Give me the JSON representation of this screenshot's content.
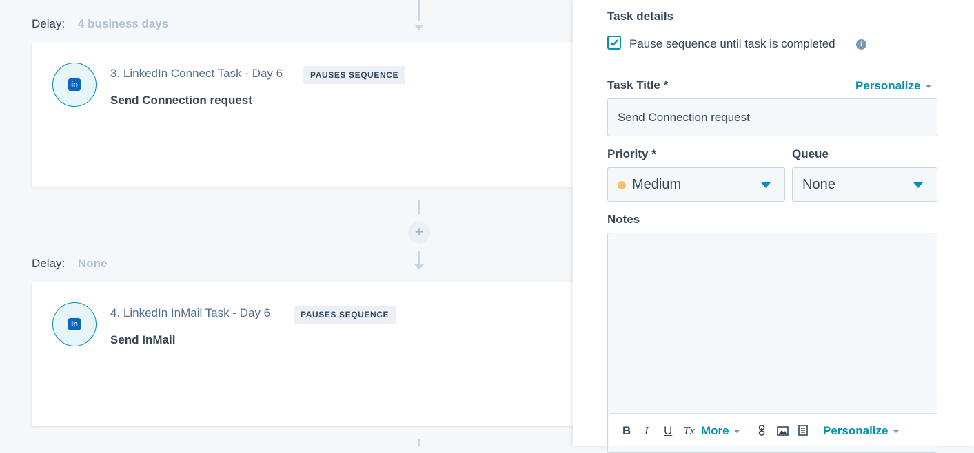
{
  "sequence": {
    "delays": [
      {
        "label": "Delay:",
        "value": "4 business days"
      },
      {
        "label": "Delay:",
        "value": "None"
      }
    ],
    "add_step_symbol": "+",
    "steps": [
      {
        "title": "3. LinkedIn Connect Task - Day 6",
        "badge": "PAUSES SEQUENCE",
        "subtitle": "Send Connection request",
        "icon": "linkedin-icon",
        "icon_text": "in"
      },
      {
        "title": "4. LinkedIn InMail Task - Day 6",
        "badge": "PAUSES SEQUENCE",
        "subtitle": "Send InMail",
        "icon": "linkedin-icon",
        "icon_text": "in"
      }
    ]
  },
  "task_panel": {
    "heading": "Task details",
    "pause_checkbox": {
      "label": "Pause sequence until task is completed",
      "checked": true,
      "info_icon": "info-icon",
      "info_text": "i"
    },
    "task_title": {
      "label": "Task Title *",
      "value": "Send Connection request",
      "personalize": "Personalize"
    },
    "priority": {
      "label": "Priority *",
      "value": "Medium",
      "dot_color": "#f5c26b"
    },
    "queue": {
      "label": "Queue",
      "value": "None"
    },
    "notes": {
      "label": "Notes",
      "value": ""
    },
    "toolbar": {
      "bold": "B",
      "italic": "I",
      "underline": "U",
      "clear_format": "Tx",
      "more": "More",
      "personalize": "Personalize",
      "icons": [
        "bold-icon",
        "italic-icon",
        "underline-icon",
        "clear-format-icon",
        "link-icon",
        "image-icon",
        "document-icon"
      ]
    }
  },
  "colors": {
    "accent": "#0091ae",
    "linkedin": "#0a66c2",
    "text": "#33475b",
    "muted": "#b0c1d4"
  }
}
